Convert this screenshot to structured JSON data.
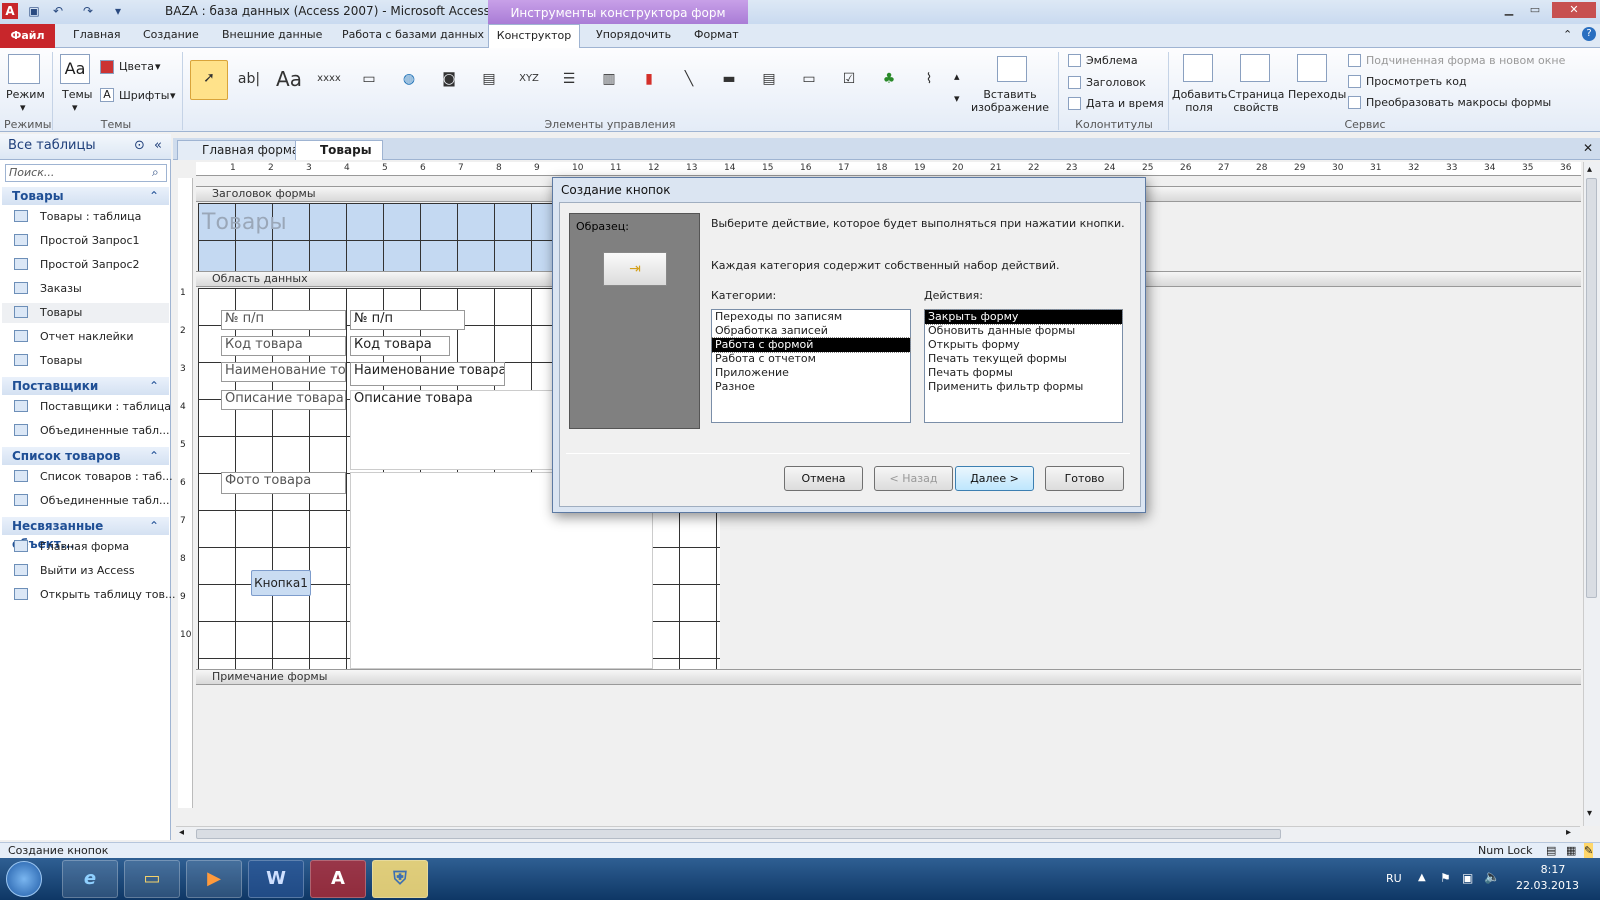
{
  "window": {
    "title": "BAZA : база данных (Access 2007)  -  Microsoft Access",
    "context_tab": "Инструменты конструктора форм"
  },
  "ribbon_tabs": [
    "Файл",
    "Главная",
    "Создание",
    "Внешние данные",
    "Работа с базами данных",
    "Конструктор",
    "Упорядочить",
    "Формат"
  ],
  "ribbon": {
    "rezhim": "Режим",
    "temy": "Темы",
    "cveta": "Цвета",
    "shrifty": "Шрифты",
    "group_rezhimy": "Режимы",
    "group_temy": "Темы",
    "group_elements": "Элементы управления",
    "vstavit": "Вставить изображение",
    "emblema": "Эмблема",
    "zagolovok": "Заголовок",
    "data_vremya": "Дата и время",
    "group_kolon": "Колонтитулы",
    "dobavit": "Добавить поля",
    "stranica": "Страница свойств",
    "perehody": "Переходы",
    "podchin": "Подчиненная форма в новом окне",
    "prosmotr": "Просмотреть код",
    "preobraz": "Преобразовать макросы формы",
    "group_servis": "Сервис"
  },
  "nav": {
    "header": "Все таблицы",
    "search_placeholder": "Поиск...",
    "groups": [
      {
        "name": "Товары",
        "items": [
          "Товары : таблица",
          "Простой Запрос1",
          "Простой Запрос2",
          "Заказы",
          "Товары",
          "Отчет наклейки",
          "Товары"
        ]
      },
      {
        "name": "Поставщики",
        "items": [
          "Поставщики : таблица",
          "Объединенные табл..."
        ]
      },
      {
        "name": "Список товаров",
        "items": [
          "Список товаров : таб...",
          "Объединенные табл..."
        ]
      },
      {
        "name": "Несвязанные объект...",
        "items": [
          "Главная форма",
          "Выйти из Access",
          "Открыть таблицу тов..."
        ]
      }
    ]
  },
  "doc_tabs": [
    "Главная форма",
    "Товары"
  ],
  "ruler_marks": [
    "1",
    "2",
    "3",
    "4",
    "5",
    "6",
    "7",
    "8",
    "9",
    "10",
    "11",
    "12",
    "13",
    "14",
    "15",
    "16",
    "17",
    "18",
    "19",
    "20",
    "21",
    "22",
    "23",
    "24",
    "25",
    "26",
    "27",
    "28",
    "29",
    "30",
    "31",
    "32",
    "33",
    "34",
    "35",
    "36"
  ],
  "vruler_marks": [
    "1",
    "2",
    "3",
    "4",
    "5",
    "6",
    "7",
    "8",
    "9",
    "10"
  ],
  "form": {
    "sec_header": "Заголовок формы",
    "title_label": "Товары",
    "sec_data": "Область данных",
    "labels": [
      "№ п/п",
      "Код товара",
      "Наименование това",
      "Описание товара",
      "Фото товара"
    ],
    "fields": [
      "№ п/п",
      "Код товара",
      "Наименование товара",
      "Описание товара"
    ],
    "button": "Кнопка1",
    "sec_footer": "Примечание формы"
  },
  "dialog": {
    "title": "Создание кнопок",
    "sample_label": "Образец:",
    "line1": "Выберите действие, которое будет выполняться при нажатии кнопки.",
    "line2": "Каждая категория содержит собственный набор действий.",
    "cat_label": "Категории:",
    "categories": [
      "Переходы по записям",
      "Обработка записей",
      "Работа с формой",
      "Работа с отчетом",
      "Приложение",
      "Разное"
    ],
    "cat_selected": 2,
    "act_label": "Действия:",
    "actions": [
      "Закрыть форму",
      "Обновить данные формы",
      "Открыть форму",
      "Печать текущей формы",
      "Печать формы",
      "Применить фильтр формы"
    ],
    "act_selected": 0,
    "btn_cancel": "Отмена",
    "btn_back": "< Назад",
    "btn_next": "Далее >",
    "btn_finish": "Готово"
  },
  "status": {
    "left": "Создание кнопок",
    "numlock": "Num Lock"
  },
  "tray": {
    "lang": "RU",
    "time": "8:17",
    "date": "22.03.2013"
  }
}
